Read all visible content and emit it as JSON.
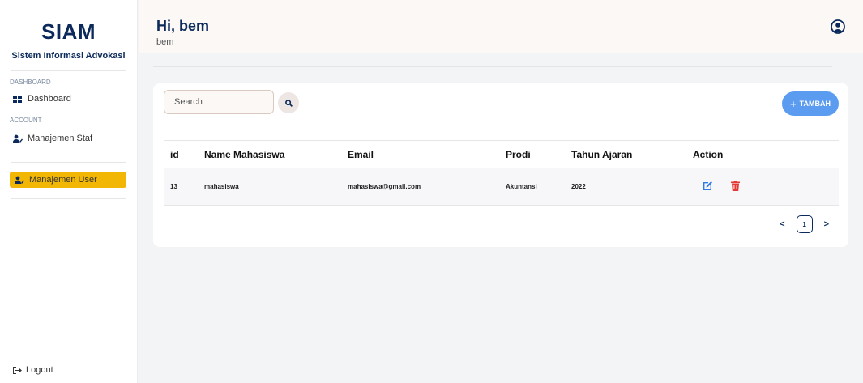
{
  "brand": {
    "title": "SIAM",
    "subtitle": "Sistem Informasi Advokasi"
  },
  "sidebar": {
    "sections": [
      {
        "label": "DASHBOARD"
      },
      {
        "label": "ACCOUNT"
      }
    ],
    "items": [
      {
        "label": "Dashboard",
        "icon": "grid-icon"
      },
      {
        "label": "Manajemen Staf",
        "icon": "user-edit-icon"
      },
      {
        "label": "Manajemen User",
        "icon": "user-edit-icon",
        "active": true
      }
    ],
    "logout": "Logout"
  },
  "header": {
    "greeting": "Hi, bem",
    "username": "bem",
    "avatar_icon": "user-circle-icon"
  },
  "toolbar": {
    "search_placeholder": "Search",
    "search_icon": "search-icon",
    "add_label": "TAMBAH"
  },
  "table": {
    "columns": [
      "id",
      "Name Mahasiswa",
      "Email",
      "Prodi",
      "Tahun Ajaran",
      "Action"
    ],
    "rows": [
      {
        "id": "13",
        "name": "mahasiswa",
        "email": "mahasiswa@gmail.com",
        "prodi": "Akuntansi",
        "tahun": "2022"
      }
    ]
  },
  "pagination": {
    "prev": "<",
    "current": "1",
    "next": ">"
  },
  "colors": {
    "brand_navy": "#0b2a5b",
    "active_item": "#f2b705",
    "add_button": "#5b9cf0",
    "edit_icon": "#2d7be5",
    "delete_icon": "#e53935"
  }
}
